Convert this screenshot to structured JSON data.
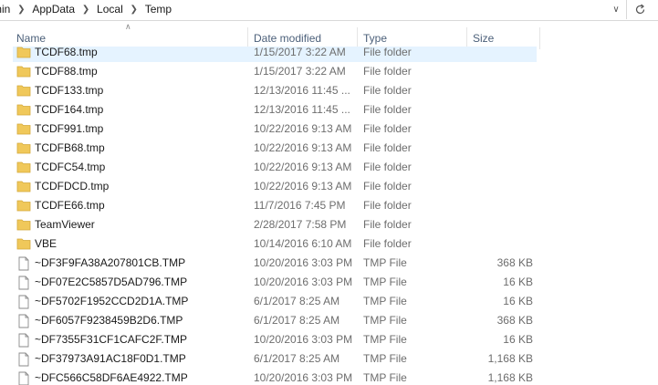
{
  "address": {
    "crumbs": [
      "min",
      "AppData",
      "Local",
      "Temp"
    ]
  },
  "columns": {
    "name": "Name",
    "date": "Date modified",
    "type": "Type",
    "size": "Size"
  },
  "colors": {
    "folder": "#f0c85a",
    "selected_row": "#e5f3ff",
    "header_text": "#4c607a"
  },
  "files": [
    {
      "name": "TCDF68.tmp",
      "date": "1/15/2017 3:22 AM",
      "type": "File folder",
      "size": "",
      "icon": "folder-icon"
    },
    {
      "name": "TCDF88.tmp",
      "date": "1/15/2017 3:22 AM",
      "type": "File folder",
      "size": "",
      "icon": "folder-icon"
    },
    {
      "name": "TCDF133.tmp",
      "date": "12/13/2016 11:45 ...",
      "type": "File folder",
      "size": "",
      "icon": "folder-icon"
    },
    {
      "name": "TCDF164.tmp",
      "date": "12/13/2016 11:45 ...",
      "type": "File folder",
      "size": "",
      "icon": "folder-icon"
    },
    {
      "name": "TCDF991.tmp",
      "date": "10/22/2016 9:13 AM",
      "type": "File folder",
      "size": "",
      "icon": "folder-icon"
    },
    {
      "name": "TCDFB68.tmp",
      "date": "10/22/2016 9:13 AM",
      "type": "File folder",
      "size": "",
      "icon": "folder-icon"
    },
    {
      "name": "TCDFC54.tmp",
      "date": "10/22/2016 9:13 AM",
      "type": "File folder",
      "size": "",
      "icon": "folder-icon"
    },
    {
      "name": "TCDFDCD.tmp",
      "date": "10/22/2016 9:13 AM",
      "type": "File folder",
      "size": "",
      "icon": "folder-icon"
    },
    {
      "name": "TCDFE66.tmp",
      "date": "11/7/2016 7:45 PM",
      "type": "File folder",
      "size": "",
      "icon": "folder-icon"
    },
    {
      "name": "TeamViewer",
      "date": "2/28/2017 7:58 PM",
      "type": "File folder",
      "size": "",
      "icon": "folder-icon"
    },
    {
      "name": "VBE",
      "date": "10/14/2016 6:10 AM",
      "type": "File folder",
      "size": "",
      "icon": "folder-icon"
    },
    {
      "name": "~DF3F9FA38A207801CB.TMP",
      "date": "10/20/2016 3:03 PM",
      "type": "TMP File",
      "size": "368 KB",
      "icon": "file-icon"
    },
    {
      "name": "~DF07E2C5857D5AD796.TMP",
      "date": "10/20/2016 3:03 PM",
      "type": "TMP File",
      "size": "16 KB",
      "icon": "file-icon"
    },
    {
      "name": "~DF5702F1952CCD2D1A.TMP",
      "date": "6/1/2017 8:25 AM",
      "type": "TMP File",
      "size": "16 KB",
      "icon": "file-icon"
    },
    {
      "name": "~DF6057F9238459B2D6.TMP",
      "date": "6/1/2017 8:25 AM",
      "type": "TMP File",
      "size": "368 KB",
      "icon": "file-icon"
    },
    {
      "name": "~DF7355F31CF1CAFC2F.TMP",
      "date": "10/20/2016 3:03 PM",
      "type": "TMP File",
      "size": "16 KB",
      "icon": "file-icon"
    },
    {
      "name": "~DF37973A91AC18F0D1.TMP",
      "date": "6/1/2017 8:25 AM",
      "type": "TMP File",
      "size": "1,168 KB",
      "icon": "file-icon"
    },
    {
      "name": "~DFC566C58DF6AE4922.TMP",
      "date": "10/20/2016 3:03 PM",
      "type": "TMP File",
      "size": "1,168 KB",
      "icon": "file-icon"
    }
  ]
}
